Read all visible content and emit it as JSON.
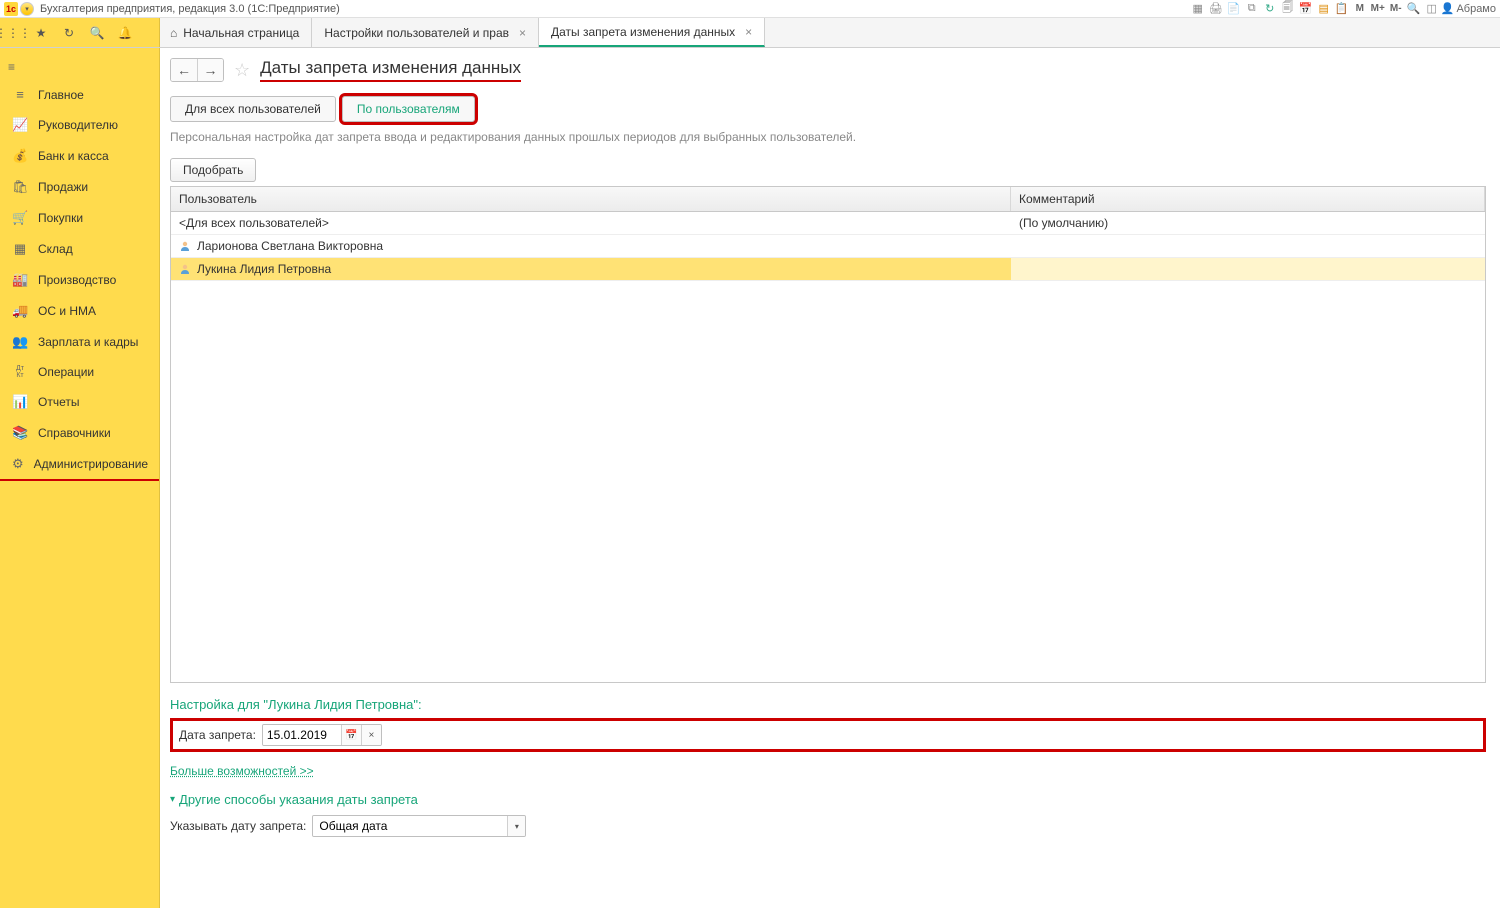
{
  "titlebar": {
    "app_title": "Бухгалтерия предприятия, редакция 3.0  (1С:Предприятие)",
    "user": "Абрамо",
    "m_labels": [
      "M",
      "M+",
      "M-"
    ]
  },
  "quickbar_tabs": {
    "home": "Начальная страница",
    "settings": "Настройки пользователей и прав",
    "dates": "Даты запрета изменения данных"
  },
  "sidebar": {
    "items": [
      {
        "icon": "≡",
        "label": "Главное"
      },
      {
        "icon": "📈",
        "label": "Руководителю"
      },
      {
        "icon": "💰",
        "label": "Банк и касса"
      },
      {
        "icon": "🛍",
        "label": "Продажи"
      },
      {
        "icon": "🛒",
        "label": "Покупки"
      },
      {
        "icon": "▦",
        "label": "Склад"
      },
      {
        "icon": "🏭",
        "label": "Производство"
      },
      {
        "icon": "🚚",
        "label": "ОС и НМА"
      },
      {
        "icon": "👥",
        "label": "Зарплата и кадры"
      },
      {
        "icon": "Дт Кт",
        "label": "Операции"
      },
      {
        "icon": "📊",
        "label": "Отчеты"
      },
      {
        "icon": "📚",
        "label": "Справочники"
      },
      {
        "icon": "⚙",
        "label": "Администрирование"
      }
    ]
  },
  "page": {
    "title": "Даты запрета изменения данных",
    "view_tabs": {
      "all": "Для всех пользователей",
      "byuser": "По пользователям"
    },
    "hint": "Персональная настройка дат запрета ввода и редактирования данных прошлых периодов для выбранных пользователей.",
    "pick_button": "Подобрать",
    "table": {
      "headers": {
        "user": "Пользователь",
        "comment": "Комментарий"
      },
      "rows": [
        {
          "icon": "",
          "user": "<Для всех пользователей>",
          "comment": "(По умолчанию)",
          "selected": false
        },
        {
          "icon": "u",
          "user": "Ларионова Светлана Викторовна",
          "comment": "",
          "selected": false
        },
        {
          "icon": "u",
          "user": "Лукина Лидия Петровна",
          "comment": "",
          "selected": true
        }
      ]
    },
    "config_title": "Настройка для \"Лукина Лидия Петровна\":",
    "date_label": "Дата запрета:",
    "date_value": "15.01.2019",
    "more_link": "Больше возможностей >>",
    "other_ways_title": "Другие способы указания даты запрета",
    "specify_label": "Указывать дату запрета:",
    "specify_value": "Общая дата"
  }
}
